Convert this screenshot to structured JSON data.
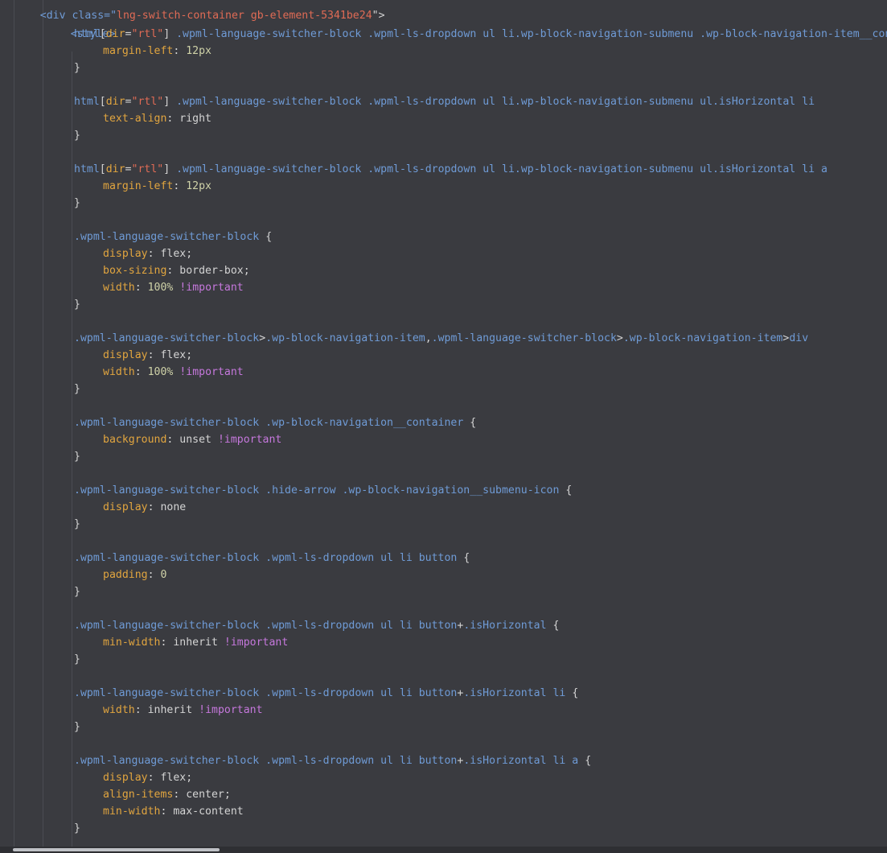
{
  "editor": {
    "cutoff_top": {
      "open": "<div class=\"",
      "class_value": "lng-switch-container gb-element-5341be24",
      "close": "\">"
    },
    "style_open": "<style>",
    "rules": [
      {
        "selector_parts": [
          {
            "t": "html",
            "c": "sel"
          },
          {
            "t": "[",
            "c": "punc"
          },
          {
            "t": "dir",
            "c": "attr"
          },
          {
            "t": "=",
            "c": "punc"
          },
          {
            "t": "\"rtl\"",
            "c": "str"
          },
          {
            "t": "]",
            "c": "punc"
          },
          {
            "t": " .wpml-language-switcher-block .wpml-ls-dropdown ul li.wp-block-navigation-submenu .wp-block-navigation-item__content",
            "c": "sel"
          }
        ],
        "decls": [
          [
            {
              "t": "margin-left",
              "c": "prop"
            },
            {
              "t": ": ",
              "c": "punc"
            },
            {
              "t": "12px",
              "c": "num"
            }
          ]
        ]
      },
      {
        "selector_parts": [
          {
            "t": "html",
            "c": "sel"
          },
          {
            "t": "[",
            "c": "punc"
          },
          {
            "t": "dir",
            "c": "attr"
          },
          {
            "t": "=",
            "c": "punc"
          },
          {
            "t": "\"rtl\"",
            "c": "str"
          },
          {
            "t": "]",
            "c": "punc"
          },
          {
            "t": " .wpml-language-switcher-block .wpml-ls-dropdown ul li.wp-block-navigation-submenu ul.isHorizontal li",
            "c": "sel"
          }
        ],
        "decls": [
          [
            {
              "t": "text-align",
              "c": "prop"
            },
            {
              "t": ": ",
              "c": "punc"
            },
            {
              "t": "right",
              "c": "val"
            }
          ]
        ]
      },
      {
        "selector_parts": [
          {
            "t": "html",
            "c": "sel"
          },
          {
            "t": "[",
            "c": "punc"
          },
          {
            "t": "dir",
            "c": "attr"
          },
          {
            "t": "=",
            "c": "punc"
          },
          {
            "t": "\"rtl\"",
            "c": "str"
          },
          {
            "t": "]",
            "c": "punc"
          },
          {
            "t": " .wpml-language-switcher-block .wpml-ls-dropdown ul li.wp-block-navigation-submenu ul.isHorizontal li a",
            "c": "sel"
          }
        ],
        "decls": [
          [
            {
              "t": "margin-left",
              "c": "prop"
            },
            {
              "t": ": ",
              "c": "punc"
            },
            {
              "t": "12px",
              "c": "num"
            }
          ]
        ]
      },
      {
        "selector_parts": [
          {
            "t": ".wpml-language-switcher-block",
            "c": "sel"
          },
          {
            "t": " {",
            "c": "punc"
          }
        ],
        "decls": [
          [
            {
              "t": "display",
              "c": "prop"
            },
            {
              "t": ": ",
              "c": "punc"
            },
            {
              "t": "flex",
              "c": "val"
            },
            {
              "t": ";",
              "c": "punc"
            }
          ],
          [
            {
              "t": "box-sizing",
              "c": "prop"
            },
            {
              "t": ": ",
              "c": "punc"
            },
            {
              "t": "border-box",
              "c": "val"
            },
            {
              "t": ";",
              "c": "punc"
            }
          ],
          [
            {
              "t": "width",
              "c": "prop"
            },
            {
              "t": ": ",
              "c": "punc"
            },
            {
              "t": "100%",
              "c": "num"
            },
            {
              "t": " ",
              "c": "punc"
            },
            {
              "t": "!important",
              "c": "imp"
            }
          ]
        ]
      },
      {
        "selector_parts": [
          {
            "t": ".wpml-language-switcher-block",
            "c": "sel"
          },
          {
            "t": ">",
            "c": "punc"
          },
          {
            "t": ".wp-block-navigation-item",
            "c": "sel"
          },
          {
            "t": ",",
            "c": "punc"
          },
          {
            "t": ".wpml-language-switcher-block",
            "c": "sel"
          },
          {
            "t": ">",
            "c": "punc"
          },
          {
            "t": ".wp-block-navigation-item",
            "c": "sel"
          },
          {
            "t": ">",
            "c": "punc"
          },
          {
            "t": "div",
            "c": "sel"
          }
        ],
        "decls": [
          [
            {
              "t": "display",
              "c": "prop"
            },
            {
              "t": ": ",
              "c": "punc"
            },
            {
              "t": "flex",
              "c": "val"
            },
            {
              "t": ";",
              "c": "punc"
            }
          ],
          [
            {
              "t": "width",
              "c": "prop"
            },
            {
              "t": ": ",
              "c": "punc"
            },
            {
              "t": "100%",
              "c": "num"
            },
            {
              "t": " ",
              "c": "punc"
            },
            {
              "t": "!important",
              "c": "imp"
            }
          ]
        ]
      },
      {
        "selector_parts": [
          {
            "t": ".wpml-language-switcher-block .wp-block-navigation__container",
            "c": "sel"
          },
          {
            "t": " {",
            "c": "punc"
          }
        ],
        "decls": [
          [
            {
              "t": "background",
              "c": "prop"
            },
            {
              "t": ": ",
              "c": "punc"
            },
            {
              "t": "unset",
              "c": "val"
            },
            {
              "t": " ",
              "c": "punc"
            },
            {
              "t": "!important",
              "c": "imp"
            }
          ]
        ]
      },
      {
        "selector_parts": [
          {
            "t": ".wpml-language-switcher-block .hide-arrow .wp-block-navigation__submenu-icon",
            "c": "sel"
          },
          {
            "t": " {",
            "c": "punc"
          }
        ],
        "decls": [
          [
            {
              "t": "display",
              "c": "prop"
            },
            {
              "t": ": ",
              "c": "punc"
            },
            {
              "t": "none",
              "c": "val"
            }
          ]
        ]
      },
      {
        "selector_parts": [
          {
            "t": ".wpml-language-switcher-block .wpml-ls-dropdown ul li button",
            "c": "sel"
          },
          {
            "t": " {",
            "c": "punc"
          }
        ],
        "decls": [
          [
            {
              "t": "padding",
              "c": "prop"
            },
            {
              "t": ": ",
              "c": "punc"
            },
            {
              "t": "0",
              "c": "num"
            }
          ]
        ]
      },
      {
        "selector_parts": [
          {
            "t": ".wpml-language-switcher-block .wpml-ls-dropdown ul li button",
            "c": "sel"
          },
          {
            "t": "+",
            "c": "punc"
          },
          {
            "t": ".isHorizontal",
            "c": "sel"
          },
          {
            "t": " {",
            "c": "punc"
          }
        ],
        "decls": [
          [
            {
              "t": "min-width",
              "c": "prop"
            },
            {
              "t": ": ",
              "c": "punc"
            },
            {
              "t": "inherit",
              "c": "val"
            },
            {
              "t": " ",
              "c": "punc"
            },
            {
              "t": "!important",
              "c": "imp"
            }
          ]
        ]
      },
      {
        "selector_parts": [
          {
            "t": ".wpml-language-switcher-block .wpml-ls-dropdown ul li button",
            "c": "sel"
          },
          {
            "t": "+",
            "c": "punc"
          },
          {
            "t": ".isHorizontal li",
            "c": "sel"
          },
          {
            "t": " {",
            "c": "punc"
          }
        ],
        "decls": [
          [
            {
              "t": "width",
              "c": "prop"
            },
            {
              "t": ": ",
              "c": "punc"
            },
            {
              "t": "inherit",
              "c": "val"
            },
            {
              "t": " ",
              "c": "punc"
            },
            {
              "t": "!important",
              "c": "imp"
            }
          ]
        ]
      },
      {
        "selector_parts": [
          {
            "t": ".wpml-language-switcher-block .wpml-ls-dropdown ul li button",
            "c": "sel"
          },
          {
            "t": "+",
            "c": "punc"
          },
          {
            "t": ".isHorizontal li a",
            "c": "sel"
          },
          {
            "t": " {",
            "c": "punc"
          }
        ],
        "decls": [
          [
            {
              "t": "display",
              "c": "prop"
            },
            {
              "t": ": ",
              "c": "punc"
            },
            {
              "t": "flex",
              "c": "val"
            },
            {
              "t": ";",
              "c": "punc"
            }
          ],
          [
            {
              "t": "align-items",
              "c": "prop"
            },
            {
              "t": ": ",
              "c": "punc"
            },
            {
              "t": "center",
              "c": "val"
            },
            {
              "t": ";",
              "c": "punc"
            }
          ],
          [
            {
              "t": "min-width",
              "c": "prop"
            },
            {
              "t": ": ",
              "c": "punc"
            },
            {
              "t": "max-content",
              "c": "val"
            }
          ]
        ]
      }
    ],
    "close_brace": "}"
  },
  "colors": {
    "background": "#3a3b40",
    "selector": "#6f9bd6",
    "property": "#e1a53f",
    "string": "#e06b55",
    "important": "#c678dd",
    "number": "#cfd2a8"
  }
}
